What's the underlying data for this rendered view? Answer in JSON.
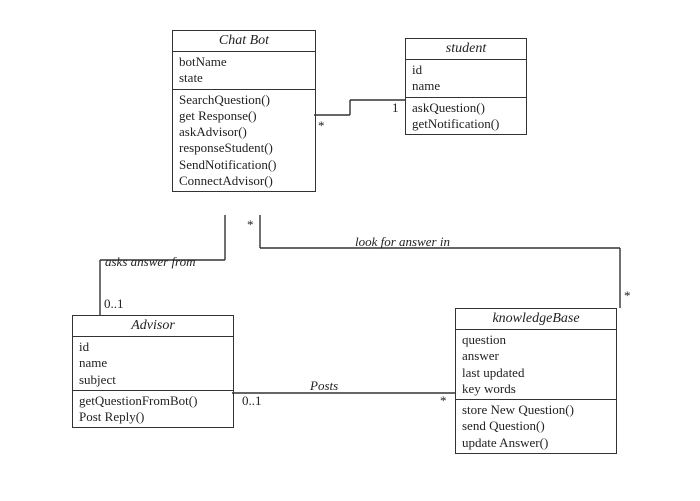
{
  "classes": {
    "chatbot": {
      "name": "Chat Bot",
      "attrs": [
        "botName",
        "state"
      ],
      "methods": [
        "SearchQuestion()",
        "get Response()",
        "askAdvisor()",
        "responseStudent()",
        "SendNotification()",
        "ConnectAdvisor()"
      ]
    },
    "student": {
      "name": "student",
      "attrs": [
        "id",
        "name"
      ],
      "methods": [
        "askQuestion()",
        "getNotification()"
      ]
    },
    "advisor": {
      "name": "Advisor",
      "attrs": [
        "id",
        "name",
        "subject"
      ],
      "methods": [
        "getQuestionFromBot()",
        "Post Reply()"
      ]
    },
    "kb": {
      "name": "knowledgeBase",
      "attrs": [
        "question",
        "answer",
        "last updated",
        "key words"
      ],
      "methods": [
        "store New Question()",
        "send Question()",
        "update Answer()"
      ]
    }
  },
  "relations": {
    "chatbot_student": {
      "mult_chatbot": "*",
      "mult_student": "1"
    },
    "chatbot_kb": {
      "label": "look for answer in",
      "mult_chatbot": "*",
      "mult_kb": "*"
    },
    "chatbot_advisor": {
      "label": "asks answer from",
      "mult_advisor": "0..1"
    },
    "advisor_kb": {
      "label": "Posts",
      "mult_advisor": "0..1",
      "mult_kb": "*"
    }
  }
}
